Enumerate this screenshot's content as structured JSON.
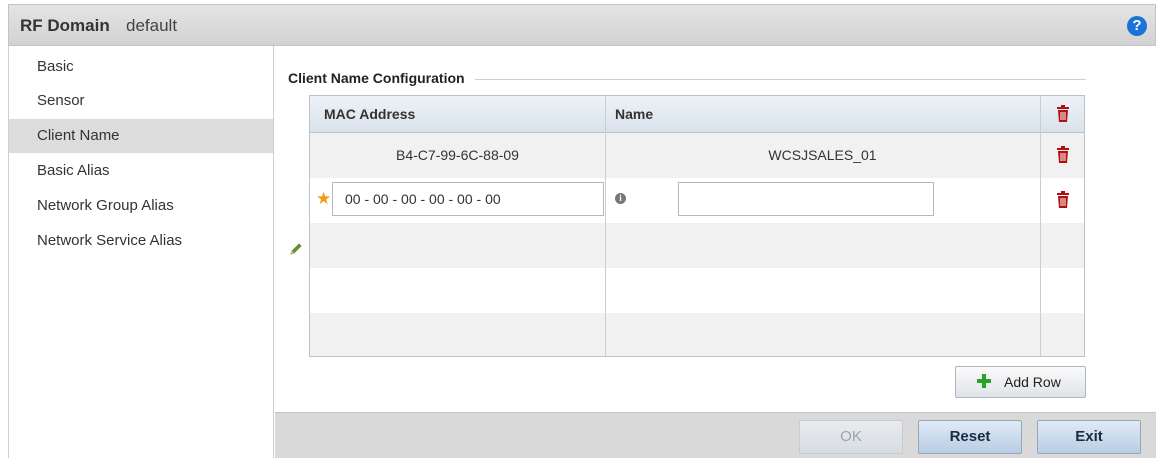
{
  "header": {
    "title": "RF Domain",
    "subtitle": "default",
    "help_icon": "question-circle-icon"
  },
  "sidebar": {
    "items": [
      {
        "label": "Basic"
      },
      {
        "label": "Sensor"
      },
      {
        "label": "Client Name",
        "active": true
      },
      {
        "label": "Basic Alias"
      },
      {
        "label": "Network Group Alias"
      },
      {
        "label": "Network Service Alias"
      }
    ]
  },
  "section": {
    "title": "Client Name Configuration"
  },
  "table": {
    "columns": [
      "MAC Address",
      "Name"
    ],
    "rows": [
      {
        "mac": "B4-C7-99-6C-88-09",
        "name": "WCSJSALES_01"
      }
    ],
    "new_row": {
      "mac_value": "00 - 00 - 00 - 00 - 00 - 00",
      "name_value": ""
    }
  },
  "buttons": {
    "add_row": "Add Row",
    "ok": "OK",
    "reset": "Reset",
    "exit": "Exit"
  },
  "colors": {
    "delete_icon": "#b01010",
    "required_star": "#f29a1a",
    "help_icon": "#1a73d6",
    "add_plus": "#2aa12a",
    "active_nav": "#dcdcdc"
  }
}
